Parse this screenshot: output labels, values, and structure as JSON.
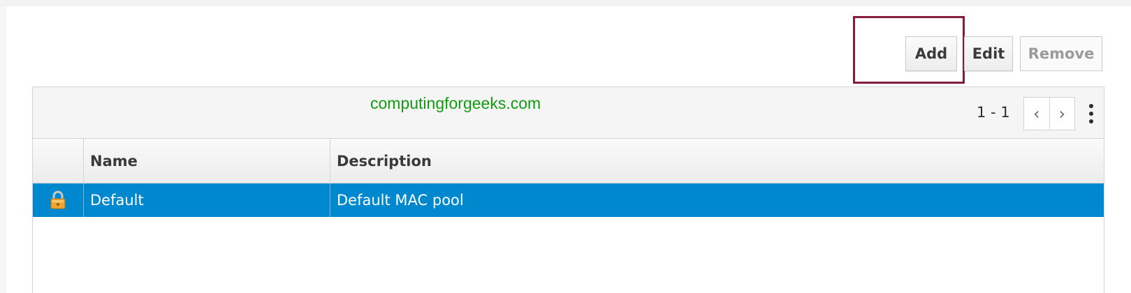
{
  "toolbar": {
    "add_label": "Add",
    "edit_label": "Edit",
    "remove_label": "Remove"
  },
  "watermark": "computingforgeeks.com",
  "pager": {
    "range": "1 - 1",
    "prev_icon": "chevron-left-icon",
    "next_icon": "chevron-right-icon",
    "menu_icon": "kebab-menu-icon"
  },
  "table": {
    "columns": [
      "",
      "Name",
      "Description"
    ],
    "rows": [
      {
        "icon": "lock-icon",
        "name": "Default",
        "description": "Default MAC pool",
        "selected": true
      }
    ]
  },
  "colors": {
    "selection": "#0088ce",
    "highlight_box": "#861c3c",
    "watermark": "#129a12"
  }
}
